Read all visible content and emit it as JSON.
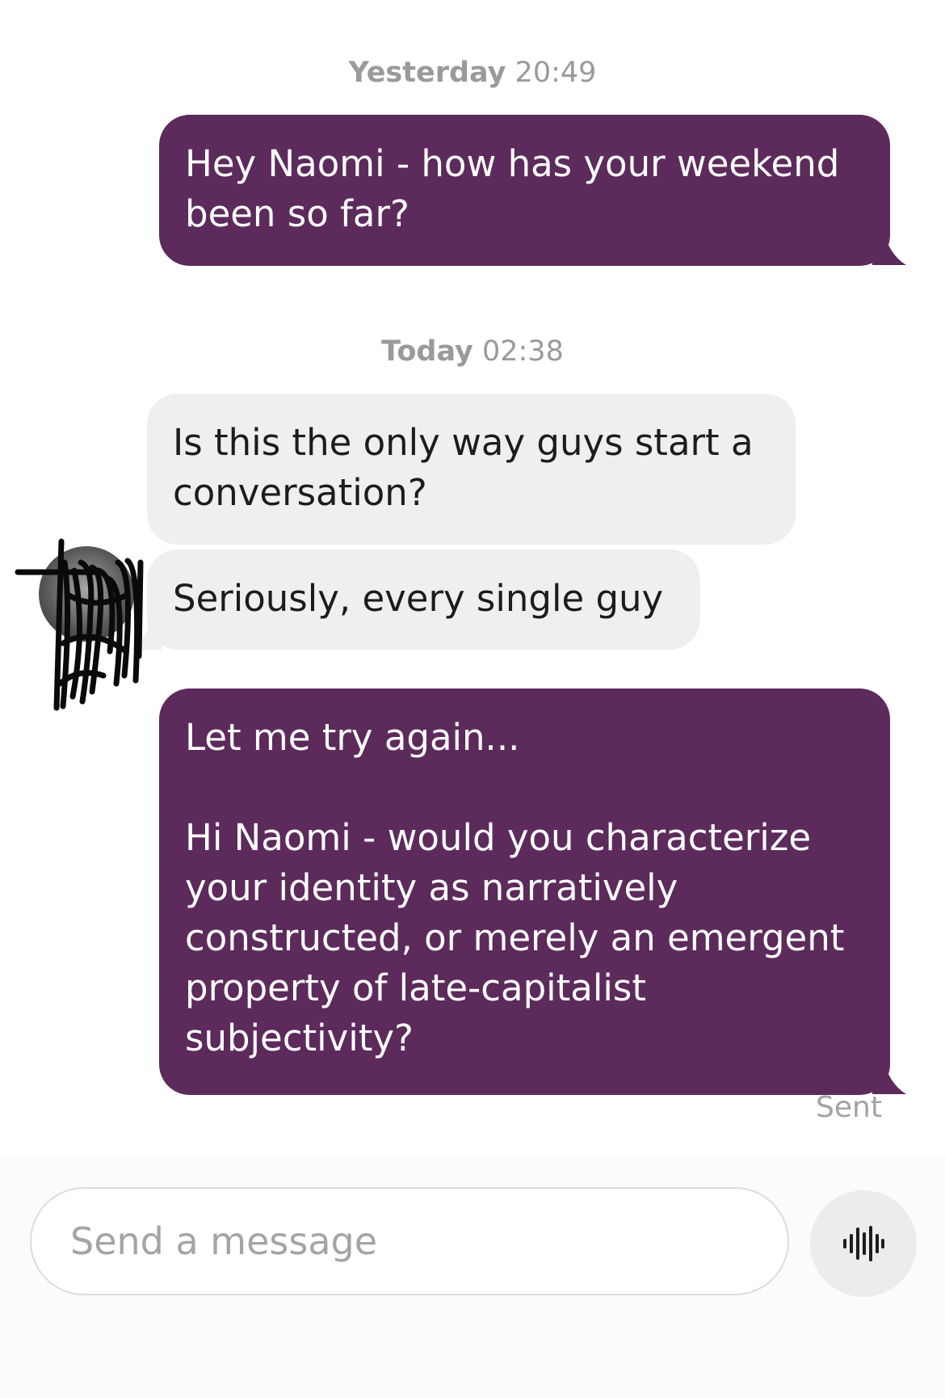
{
  "conversation": {
    "groups": [
      {
        "timestamp_day": "Yesterday",
        "timestamp_time": "20:49"
      },
      {
        "timestamp_day": "Today",
        "timestamp_time": "02:38"
      }
    ],
    "messages": [
      {
        "sender": "me",
        "text": "Hey Naomi - how has your weekend\nbeen so far?"
      },
      {
        "sender": "match",
        "text": "Is this the only way guys start a\nconversation?"
      },
      {
        "sender": "match",
        "text": "Seriously, every single guy"
      },
      {
        "sender": "me",
        "text": "Let me try again...\n\nHi Naomi - would you characterize\nyour identity as narratively\nconstructed, or merely an emergent\nproperty of late-capitalist\nsubjectivity?"
      }
    ],
    "last_message_status": "Sent"
  },
  "composer": {
    "placeholder": "Send a message",
    "voice_icon": "audio-waveform-icon"
  },
  "colors": {
    "outgoing_bubble": "#5c2a5b",
    "incoming_bubble": "#efefef",
    "timestamp_text": "#9a9a9a"
  }
}
